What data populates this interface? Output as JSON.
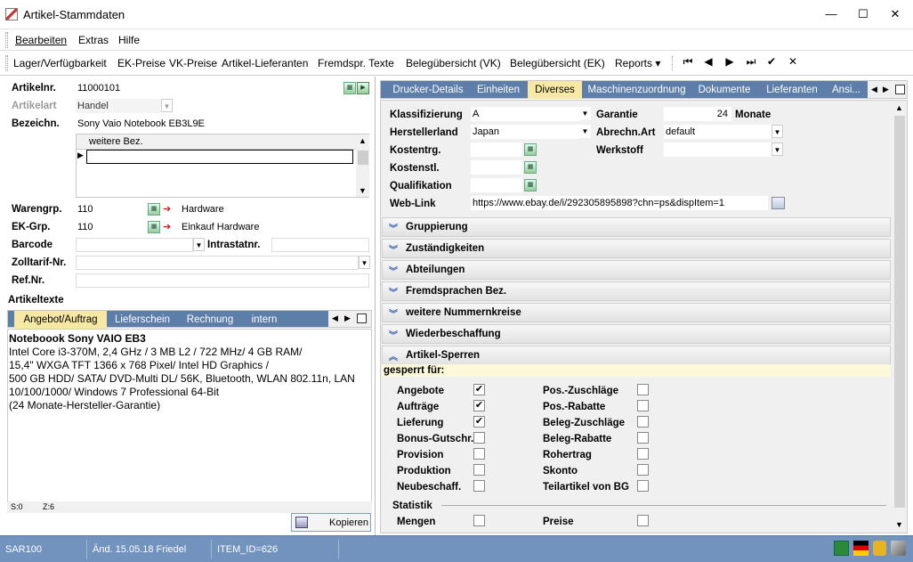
{
  "window": {
    "title": "Artikel-Stammdaten",
    "minimize": "—",
    "maximize": "☐",
    "close": "✕"
  },
  "menu": {
    "items": [
      "Bearbeiten",
      "Extras",
      "Hilfe"
    ]
  },
  "toolbar": {
    "items": [
      "Lager/Verfügbarkeit",
      "EK-Preise",
      "VK-Preise",
      "Artikel-Lieferanten",
      "Fremdspr. Texte",
      "Belegübersicht (VK)",
      "Belegübersicht (EK)",
      "Reports ▾"
    ],
    "nav": [
      "⏮",
      "◀",
      "▶",
      "⏭",
      "✔",
      "✕"
    ]
  },
  "left": {
    "artikelnr": {
      "label": "Artikelnr.",
      "value": "11000101"
    },
    "artikelart": {
      "label": "Artikelart",
      "value": "Handel"
    },
    "bezeichnung": {
      "label": "Bezeichn.",
      "value": "Sony Vaio Notebook EB3L9E"
    },
    "weitere_bez": {
      "header": "weitere Bez.",
      "row_marker": "▶"
    },
    "warengrp": {
      "label": "Warengrp.",
      "value": "110",
      "desc": "Hardware"
    },
    "ekgrp": {
      "label": "EK-Grp.",
      "value": "110",
      "desc": "Einkauf Hardware"
    },
    "barcode": {
      "label": "Barcode",
      "value": ""
    },
    "intrastat": {
      "label": "Intrastatnr.",
      "value": ""
    },
    "zolltarif": {
      "label": "Zolltarif-Nr.",
      "value": ""
    },
    "refnr": {
      "label": "Ref.Nr.",
      "value": ""
    },
    "artikeltexte_label": "Artikeltexte",
    "text_tabs": [
      "Angebot/Auftrag",
      "Lieferschein",
      "Rechnung",
      "intern"
    ],
    "text_lines": [
      "Noteboook Sony VAIO EB3",
      "Intel Core i3-370M, 2,4 GHz / 3 MB L2 / 722 MHz/ 4 GB RAM/",
      "15,4\" WXGA TFT 1366 x 768 Pixel/ Intel HD Graphics /",
      "500 GB HDD/ SATA/ DVD-Multi DL/ 56K, Bluetooth, WLAN 802.11n, LAN",
      "10/100/1000/ Windows 7 Professional 64-Bit",
      "(24 Monate-Hersteller-Garantie)"
    ],
    "status_s": "S:0",
    "status_z": "Z:6",
    "kopieren": "Kopieren"
  },
  "right": {
    "tabs": [
      "Drucker-Details",
      "Einheiten",
      "Diverses",
      "Maschinenzuordnung",
      "Dokumente",
      "Lieferanten",
      "Ansi..."
    ],
    "klassifizierung": {
      "label": "Klassifizierung",
      "value": "A"
    },
    "garantie": {
      "label": "Garantie",
      "value": "24",
      "unit": "Monate"
    },
    "herstellerland": {
      "label": "Herstellerland",
      "value": "Japan"
    },
    "abrechn": {
      "label": "Abrechn.Art",
      "value": "default"
    },
    "kostentrg": {
      "label": "Kostentrg.",
      "value": ""
    },
    "werkstoff": {
      "label": "Werkstoff",
      "value": ""
    },
    "kostenstl": {
      "label": "Kostenstl.",
      "value": ""
    },
    "qualifikation": {
      "label": "Qualifikation",
      "value": ""
    },
    "weblink": {
      "label": "Web-Link",
      "value": "https://www.ebay.de/i/292305895898?chn=ps&dispItem=1"
    },
    "sections": [
      "Gruppierung",
      "Zuständigkeiten",
      "Abteilungen",
      "Fremdsprachen Bez.",
      "weitere Nummernkreise",
      "Wiederbeschaffung",
      "Artikel-Sperren"
    ],
    "gesperrt": "gesperrt für:",
    "left_checks": [
      {
        "label": "Angebote",
        "checked": true
      },
      {
        "label": "Aufträge",
        "checked": true
      },
      {
        "label": "Lieferung",
        "checked": true
      },
      {
        "label": "Bonus-Gutschr.",
        "checked": false
      },
      {
        "label": "Provision",
        "checked": false
      },
      {
        "label": "Produktion",
        "checked": false
      },
      {
        "label": "Neubeschaff.",
        "checked": false
      }
    ],
    "right_checks": [
      {
        "label": "Pos.-Zuschläge",
        "checked": false
      },
      {
        "label": "Pos.-Rabatte",
        "checked": false
      },
      {
        "label": "Beleg-Zuschläge",
        "checked": false
      },
      {
        "label": "Beleg-Rabatte",
        "checked": false
      },
      {
        "label": "Rohertrag",
        "checked": false
      },
      {
        "label": "Skonto",
        "checked": false
      },
      {
        "label": "Teilartikel von BG",
        "checked": false
      }
    ],
    "statistik": "Statistik",
    "mengen": {
      "label": "Mengen",
      "checked": false
    },
    "preise": {
      "label": "Preise",
      "checked": false
    }
  },
  "status": {
    "user": "SAR100",
    "changed": "Änd. 15.05.18 Friedel",
    "item": "ITEM_ID=626"
  }
}
